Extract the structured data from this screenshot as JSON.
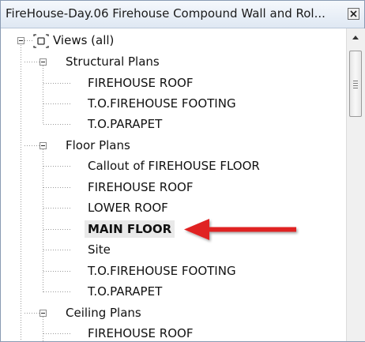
{
  "window": {
    "title": "FireHouse-Day.06 Firehouse Compound Wall and Rol...",
    "close_icon": "close-icon"
  },
  "tree": {
    "root": {
      "label": "Views (all)",
      "icon": "views-icon"
    },
    "groups": [
      {
        "label": "Structural Plans",
        "items": [
          "FIREHOUSE ROOF",
          "T.O.FIREHOUSE FOOTING",
          "T.O.PARAPET"
        ]
      },
      {
        "label": "Floor Plans",
        "items": [
          "Callout of FIREHOUSE FLOOR",
          "FIREHOUSE ROOF",
          "LOWER ROOF",
          "MAIN FLOOR",
          "Site",
          "T.O.FIREHOUSE FOOTING",
          "T.O.PARAPET"
        ]
      },
      {
        "label": "Ceiling Plans",
        "items": [
          "FIREHOUSE ROOF"
        ]
      }
    ],
    "selected_item": "MAIN FLOOR"
  },
  "annotation": {
    "arrow_color": "#e02020"
  },
  "scrollbar": {
    "up_icon": "scroll-up-icon"
  }
}
